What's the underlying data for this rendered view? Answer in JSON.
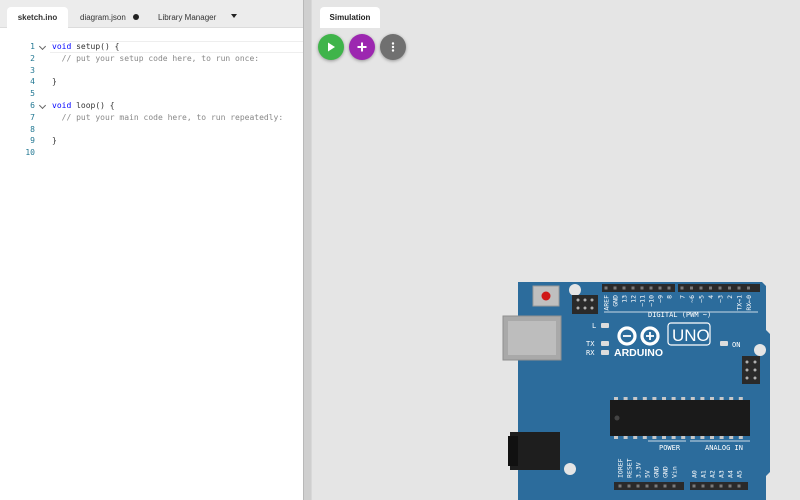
{
  "editor": {
    "tabs": [
      {
        "label": "sketch.ino"
      },
      {
        "label": "diagram.json"
      },
      {
        "label": "Library Manager"
      }
    ],
    "lines": [
      {
        "num": "1",
        "text": "void setup() {"
      },
      {
        "num": "2",
        "text": "  // put your setup code here, to run once:"
      },
      {
        "num": "3",
        "text": ""
      },
      {
        "num": "4",
        "text": "}"
      },
      {
        "num": "5",
        "text": ""
      },
      {
        "num": "6",
        "text": "void loop() {"
      },
      {
        "num": "7",
        "text": "  // put your main code here, to run repeatedly:"
      },
      {
        "num": "8",
        "text": ""
      },
      {
        "num": "9",
        "text": "}"
      },
      {
        "num": "10",
        "text": ""
      }
    ]
  },
  "simulation": {
    "tab_label": "Simulation",
    "buttons": {
      "play": "play-icon",
      "add": "plus-icon",
      "more": "more-vertical-icon"
    },
    "colors": {
      "play": "#3fb44a",
      "add": "#9c27b0",
      "more": "#707070",
      "board": "#2c6c9c"
    },
    "board": {
      "brand": "ARDUINO",
      "model": "UNO",
      "on_label": "ON",
      "l_label": "L",
      "tx_label": "TX",
      "rx_label": "RX",
      "digital_label": "DIGITAL (PWM ~)",
      "power_label": "POWER",
      "analog_label": "ANALOG IN",
      "top_pins": [
        "AREF",
        "GND",
        "13",
        "12",
        "~11",
        "~10",
        "~9",
        "8",
        "7",
        "~6",
        "~5",
        "4",
        "~3",
        "2",
        "TX→1",
        "RX←0"
      ],
      "power_pins": [
        "IOREF",
        "RESET",
        "3.3V",
        "5V",
        "GND",
        "GND",
        "Vin"
      ],
      "analog_pins": [
        "A0",
        "A1",
        "A2",
        "A3",
        "A4",
        "A5"
      ]
    }
  }
}
